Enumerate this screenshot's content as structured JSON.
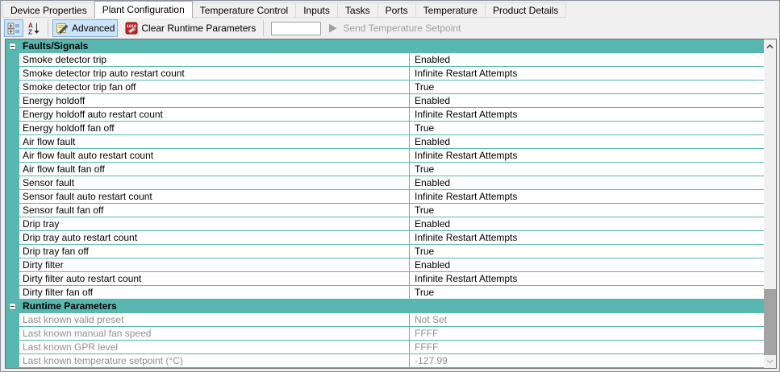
{
  "tabs": {
    "items": [
      {
        "label": "Device Properties",
        "active": false
      },
      {
        "label": "Plant Configuration",
        "active": true
      },
      {
        "label": "Temperature Control",
        "active": false
      },
      {
        "label": "Inputs",
        "active": false
      },
      {
        "label": "Tasks",
        "active": false
      },
      {
        "label": "Ports",
        "active": false
      },
      {
        "label": "Temperature",
        "active": false
      },
      {
        "label": "Product Details",
        "active": false
      }
    ]
  },
  "toolbar": {
    "categorized_icon": "categorized-view",
    "sort_icon": "sort-alphabetical",
    "advanced": {
      "label": "Advanced",
      "pressed": true,
      "icon": "edit-note"
    },
    "clear": {
      "label": "Clear Runtime Parameters",
      "icon": "binary-eraser"
    },
    "setpoint_input": {
      "value": "",
      "placeholder": ""
    },
    "send": {
      "label": "Send Temperature Setpoint",
      "enabled": false,
      "icon": "play-arrow"
    }
  },
  "grid": {
    "sections": [
      {
        "title": "Faults/Signals",
        "collapsed": false,
        "disabled": false,
        "rows": [
          {
            "name": "Smoke detector trip",
            "value": "Enabled"
          },
          {
            "name": "Smoke detector trip auto restart count",
            "value": "Infinite Restart Attempts"
          },
          {
            "name": "Smoke detector trip fan off",
            "value": "True"
          },
          {
            "name": "Energy holdoff",
            "value": "Enabled"
          },
          {
            "name": "Energy holdoff auto restart count",
            "value": "Infinite Restart Attempts"
          },
          {
            "name": "Energy holdoff fan off",
            "value": "True"
          },
          {
            "name": "Air flow fault",
            "value": "Enabled"
          },
          {
            "name": "Air flow fault auto restart count",
            "value": "Infinite Restart Attempts"
          },
          {
            "name": "Air flow fault fan off",
            "value": "True"
          },
          {
            "name": "Sensor fault",
            "value": "Enabled"
          },
          {
            "name": "Sensor fault auto restart count",
            "value": "Infinite Restart Attempts"
          },
          {
            "name": "Sensor fault fan off",
            "value": "True"
          },
          {
            "name": "Drip tray",
            "value": "Enabled"
          },
          {
            "name": "Drip tray auto restart count",
            "value": "Infinite Restart Attempts"
          },
          {
            "name": "Drip tray fan off",
            "value": "True"
          },
          {
            "name": "Dirty filter",
            "value": "Enabled"
          },
          {
            "name": "Dirty filter auto restart count",
            "value": "Infinite Restart Attempts"
          },
          {
            "name": "Dirty filter fan off",
            "value": "True"
          }
        ]
      },
      {
        "title": "Runtime Parameters",
        "collapsed": false,
        "disabled": true,
        "rows": [
          {
            "name": "Last known valid preset",
            "value": "Not Set"
          },
          {
            "name": "Last known manual fan speed",
            "value": "FFFF"
          },
          {
            "name": "Last known GPR level",
            "value": "FFFF"
          },
          {
            "name": "Last known temperature setpoint (°C)",
            "value": "-127.99"
          }
        ]
      }
    ]
  },
  "scrollbar": {
    "up_icon": "chevron-up",
    "down_icon": "chevron-down"
  },
  "colors": {
    "category_teal": "#58B7B0",
    "disabled_text": "#8F8F8F",
    "pressed_button_bg": "#CBE4F9",
    "pressed_button_border": "#7FB2E0",
    "toolbar_bg": "#F0F0F0",
    "clear_icon_red": "#CC1F1F"
  }
}
